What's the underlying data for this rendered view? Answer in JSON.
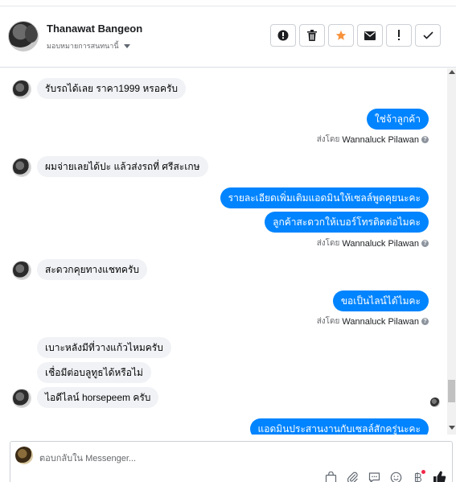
{
  "header": {
    "contact_name": "Thanawat Bangeon",
    "assign_label": "มอบหมายการสนทนานี้",
    "buttons": [
      {
        "name": "block-button",
        "icon": "block-icon"
      },
      {
        "name": "delete-button",
        "icon": "trash-icon"
      },
      {
        "name": "star-button",
        "icon": "star-icon",
        "color": "#f7923b"
      },
      {
        "name": "mark-unread-button",
        "icon": "envelope-icon"
      },
      {
        "name": "follow-up-button",
        "icon": "exclamation-icon"
      },
      {
        "name": "mark-done-button",
        "icon": "checkmark-icon"
      }
    ]
  },
  "messages": [
    {
      "dir": "in",
      "text": "รับรถได้เลย ราคา1999 หรอครับ"
    },
    {
      "dir": "out",
      "text": "ใช่จ้าลูกค้า"
    },
    {
      "dir": "meta",
      "label": "ส่งโดย",
      "who": "Wannaluck Pilawan"
    },
    {
      "dir": "in",
      "text": "ผมจ่ายเลยได้ปะ แล้วส่งรถที่ ศรีสะเกษ"
    },
    {
      "dir": "out",
      "text": "รายละเอียดเพิ่มเติมแอดมินให้เซลล์พูดคุยนะคะ"
    },
    {
      "dir": "out",
      "text": "ลูกค้าสะดวกให้เบอร์โทรติดต่อไมคะ"
    },
    {
      "dir": "meta",
      "label": "ส่งโดย",
      "who": "Wannaluck Pilawan"
    },
    {
      "dir": "in",
      "text": "สะดวกคุยทางแชทครับ"
    },
    {
      "dir": "out",
      "text": "ขอเป็นไลน์ได้ไมคะ"
    },
    {
      "dir": "meta",
      "label": "ส่งโดย",
      "who": "Wannaluck Pilawan"
    },
    {
      "dir": "in",
      "text": "เบาะหลังมีที่วางแก้วไหมครับ"
    },
    {
      "dir": "in",
      "text": "เชื่อมีต่อบลูทูธได้หรือไม่"
    },
    {
      "dir": "in",
      "text": "ไอดีไลน์ horsepeem ครับ"
    },
    {
      "dir": "out",
      "text": "แอดมินประสานงานกับเซลล์สักครู่นะคะ"
    }
  ],
  "composer": {
    "placeholder": "ตอบกลับใน Messenger..."
  },
  "colors": {
    "outgoing_bubble": "#0084ff",
    "incoming_bubble": "#f0f2f5",
    "accent_star": "#f7923b"
  }
}
